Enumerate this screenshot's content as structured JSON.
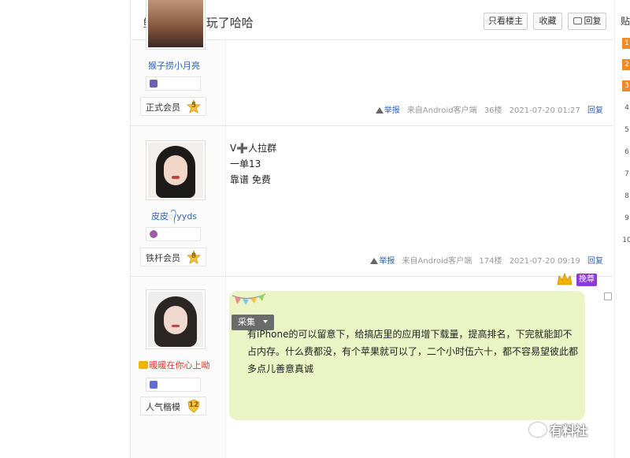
{
  "thread": {
    "title": "鲍照 好久没玩了哈哈",
    "btn_author_only": "只看楼主",
    "btn_favorite": "收藏",
    "btn_reply": "回复"
  },
  "posts": [
    {
      "username": "猴子捞小月亮",
      "level_title": "正式会员",
      "level_num": "5",
      "report": "举报",
      "client": "来自Android客户端",
      "floor": "36楼",
      "time": "2021-07-20 01:27",
      "reply": "回复"
    },
    {
      "username": "皮皮᭄yyds",
      "level_title": "铁杆会员",
      "level_num": "8",
      "lines": [
        "V➕人拉群",
        "一单13",
        "靠谱 免费"
      ],
      "report": "举报",
      "client": "来自Android客户端",
      "floor": "174楼",
      "time": "2021-07-20 09:19",
      "reply": "回复"
    },
    {
      "username": "暖暖在你心上呦",
      "level_title": "人气楷模",
      "level_num": "12",
      "vip_label": "挽尊",
      "caiji": "采集",
      "text": "有iPhone的可以留意下，给搞店里的应用增下载量，提高排名，下完就能卸不占内存。什么费都没，有个苹果就可以了，二个小时伍六十，都不容易望彼此都多点儿善意真诚"
    }
  ],
  "sidebar": {
    "title": "贴",
    "numbers": [
      "1",
      "2",
      "3",
      "4",
      "5",
      "6",
      "7",
      "8",
      "9",
      "10"
    ]
  },
  "watermark": "有料社",
  "colors": {
    "link": "#2d64b3",
    "bubble": "#eaf4c5",
    "hot_rank": "#f08a24",
    "vip": "#8c3bd3"
  }
}
